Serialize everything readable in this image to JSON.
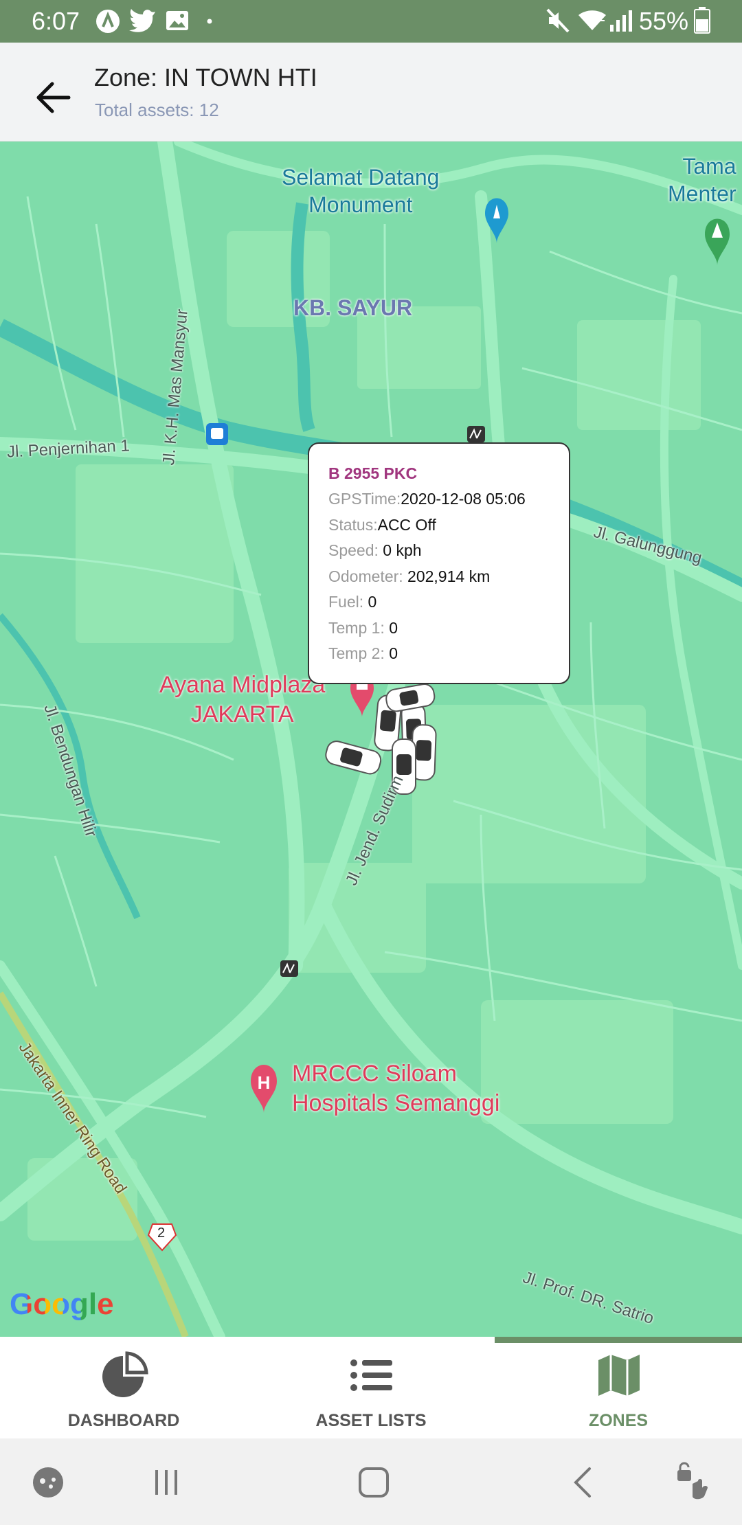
{
  "status_bar": {
    "time": "6:07",
    "battery": "55%",
    "icons": [
      "app-a-icon",
      "twitter-icon",
      "image-icon",
      "dot-icon",
      "mute-icon",
      "wifi-icon",
      "signal-icon",
      "battery-icon"
    ]
  },
  "app_bar": {
    "title": "Zone: IN TOWN HTI",
    "subtitle": "Total assets: 12",
    "back_icon": "arrow-back-icon"
  },
  "map": {
    "labels": {
      "selamat_datang": "Selamat Datang\nMonument",
      "taman": "Tama\nMenter",
      "kb_sayur": "KB. SAYUR",
      "jl_mas_mansyur": "Jl. K.H. Mas Mansyur",
      "jl_penjernihan": "Jl. Penjernihan 1",
      "jl_galunggung": "Jl. Galunggung",
      "ayana": "Ayana Midplaza\nJAKARTA",
      "jl_bendungan": "Jl. Bendungan Hilir",
      "jl_sudirman": "Jl. Jend. Sudirm",
      "mrccc": "MRCCC Siloam\nHospitals Semanggi",
      "jakarta_ring": "Jakarta Inner Ring Road",
      "route_2": "2",
      "jl_satrio": "Jl. Prof. DR. Satrio",
      "google": "Google"
    },
    "colors": {
      "land": "#7fdcaa",
      "park": "#93e6b2",
      "road": "#9eeec0",
      "water": "#4cc3ae"
    }
  },
  "info_window": {
    "plate": "B 2955 PKC",
    "rows": [
      {
        "key": "GPSTime:",
        "value": "2020-12-08 05:06"
      },
      {
        "key": "Status:",
        "value": "ACC Off"
      },
      {
        "key": "Speed:",
        "value": " 0 kph"
      },
      {
        "key": "Odometer:",
        "value": " 202,914 km"
      },
      {
        "key": "Fuel:",
        "value": " 0"
      },
      {
        "key": "Temp 1:",
        "value": " 0"
      },
      {
        "key": "Temp 2:",
        "value": " 0"
      }
    ]
  },
  "bottom_nav": {
    "items": [
      {
        "label": "DASHBOARD",
        "icon": "pie-chart-icon",
        "active": false
      },
      {
        "label": "ASSET LISTS",
        "icon": "list-icon",
        "active": false
      },
      {
        "label": "ZONES",
        "icon": "map-icon",
        "active": true
      }
    ],
    "active_color": "#6b8f67"
  },
  "system_nav": {
    "icons": [
      "game-launcher-icon",
      "recents-icon",
      "home-icon",
      "back-icon",
      "touch-lock-icon"
    ]
  }
}
